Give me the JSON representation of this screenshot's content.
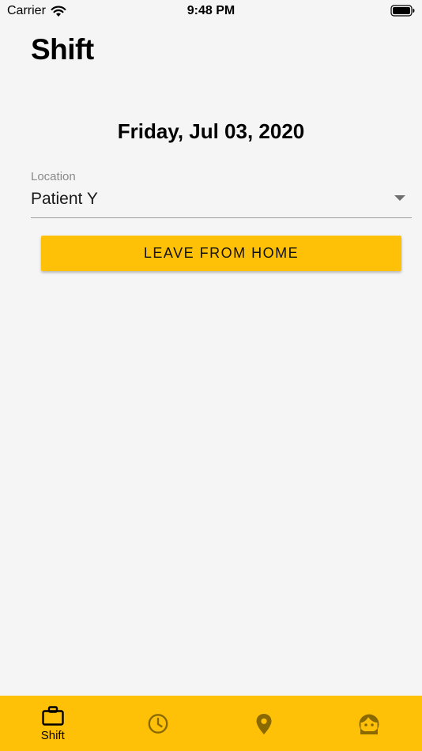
{
  "status_bar": {
    "carrier": "Carrier",
    "time": "9:48 PM",
    "icons": [
      "wifi-icon",
      "battery-icon"
    ]
  },
  "page": {
    "title": "Shift",
    "date": "Friday, Jul 03, 2020"
  },
  "location": {
    "label": "Location",
    "value": "Patient Y"
  },
  "action": {
    "label": "LEAVE FROM HOME"
  },
  "bottom_nav": {
    "items": [
      {
        "icon": "briefcase-icon",
        "label": "Shift",
        "active": true
      },
      {
        "icon": "clock-icon",
        "label": "",
        "active": false
      },
      {
        "icon": "map-pin-icon",
        "label": "",
        "active": false
      },
      {
        "icon": "face-icon",
        "label": "",
        "active": false
      }
    ]
  },
  "colors": {
    "accent": "#ffc107",
    "background": "#f5f5f5",
    "inactive_icon": "#8a6a00"
  }
}
